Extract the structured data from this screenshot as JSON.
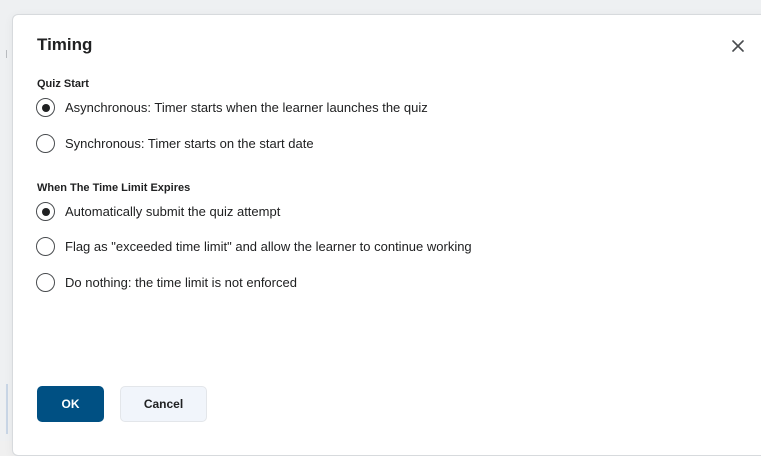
{
  "dialog": {
    "title": "Timing",
    "close_icon": "close-icon"
  },
  "quiz_start": {
    "label": "Quiz Start",
    "options": [
      {
        "label": "Asynchronous: Timer starts when the learner launches the quiz",
        "selected": true
      },
      {
        "label": "Synchronous: Timer starts on the start date",
        "selected": false
      }
    ]
  },
  "time_limit": {
    "label": "When The Time Limit Expires",
    "options": [
      {
        "label": "Automatically submit the quiz attempt",
        "selected": true
      },
      {
        "label": "Flag as \"exceeded time limit\" and allow the learner to continue working",
        "selected": false
      },
      {
        "label": "Do nothing: the time limit is not enforced",
        "selected": false
      }
    ]
  },
  "buttons": {
    "ok_label": "OK",
    "cancel_label": "Cancel"
  },
  "colors": {
    "primary": "#005083",
    "cancel_bg": "#f1f5fb"
  }
}
